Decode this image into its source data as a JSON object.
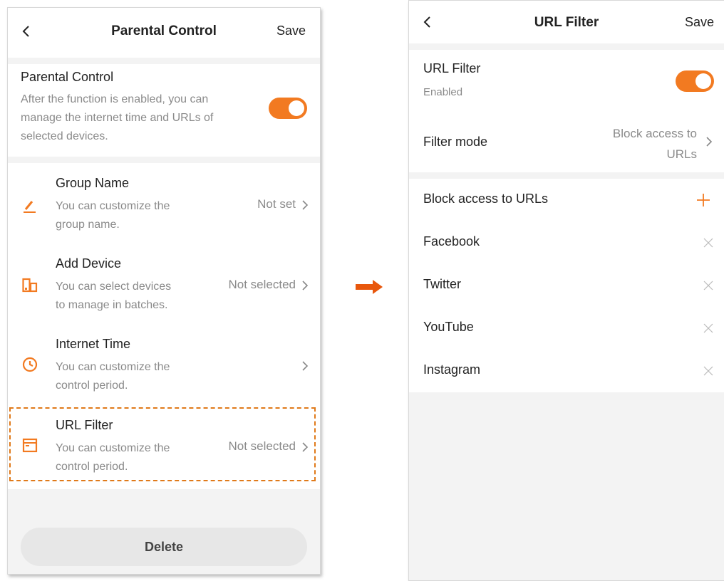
{
  "colors": {
    "accent": "#f27a21",
    "background": "#f3f3f3",
    "card": "#ffffff",
    "muted_text": "#8a8a8a"
  },
  "left": {
    "header": {
      "title": "Parental Control",
      "save_label": "Save",
      "back_icon": "chevron-left-icon"
    },
    "intro": {
      "title": "Parental Control",
      "description_lines": [
        "After the function is enabled, you can",
        "manage the internet time and URLs of",
        "selected devices."
      ],
      "toggle_on": true
    },
    "rows": [
      {
        "icon": "pencil-icon",
        "title": "Group Name",
        "desc_lines": [
          "You can customize the",
          "group name."
        ],
        "value": "Not set"
      },
      {
        "icon": "devices-icon",
        "title": "Add Device",
        "desc_lines": [
          "You can select devices",
          "to manage in batches."
        ],
        "value": "Not selected"
      },
      {
        "icon": "clock-icon",
        "title": "Internet Time",
        "desc_lines": [
          "You can customize the",
          "control period."
        ],
        "value": ""
      },
      {
        "icon": "browser-window-icon",
        "title": "URL Filter",
        "desc_lines": [
          "You can customize the",
          "control period."
        ],
        "value": "Not selected"
      }
    ],
    "delete_label": "Delete"
  },
  "transition_icon": "arrow-right-icon",
  "right": {
    "header": {
      "title": "URL Filter",
      "save_label": "Save",
      "back_icon": "chevron-left-icon"
    },
    "url_filter": {
      "title": "URL Filter",
      "status": "Enabled",
      "toggle_on": true
    },
    "filter_mode": {
      "label": "Filter mode",
      "value_lines": [
        "Block access to",
        "URLs"
      ]
    },
    "block_list": {
      "header": "Block access to URLs",
      "add_icon": "plus-icon",
      "remove_icon": "close-icon",
      "items": [
        "Facebook",
        "Twitter",
        "YouTube",
        "Instagram"
      ]
    }
  }
}
